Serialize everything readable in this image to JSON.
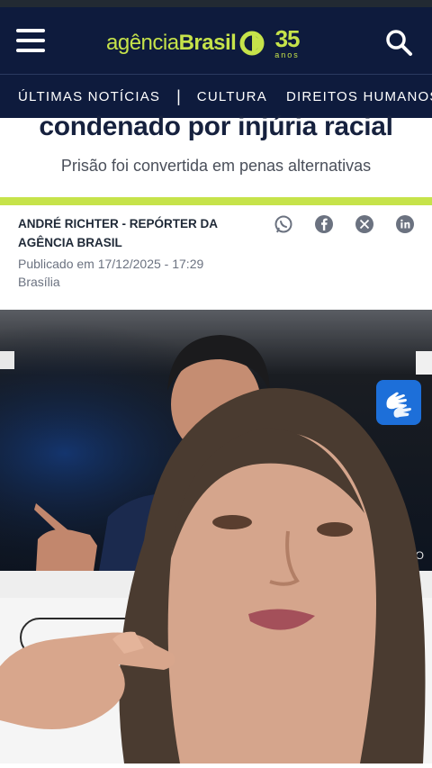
{
  "header": {
    "logo_regular": "agência",
    "logo_bold": "Brasil",
    "anniversary_number": "35",
    "anniversary_label": "anos"
  },
  "nav": {
    "items": [
      "ÚLTIMAS NOTÍCIAS",
      "CULTURA",
      "DIREITOS HUMANOS"
    ],
    "separator": "|"
  },
  "article": {
    "headline": "condenado por injúria racial",
    "subheadline": "Prisão foi convertida em penas alternativas",
    "author": "André Richter - Repórter da Agência Brasil",
    "published": "Publicado em 17/12/2025 - 17:29",
    "location": "Brasília",
    "photo_credit_fragment": "DO"
  },
  "share": {
    "icons": [
      "whatsapp-icon",
      "facebook-icon",
      "x-icon",
      "linkedin-icon"
    ]
  },
  "colors": {
    "header_bg": "#0e1b3d",
    "brand_green": "#c6e34a",
    "headline_text": "#16213e",
    "accessibility_blue": "#1d6fd9"
  }
}
